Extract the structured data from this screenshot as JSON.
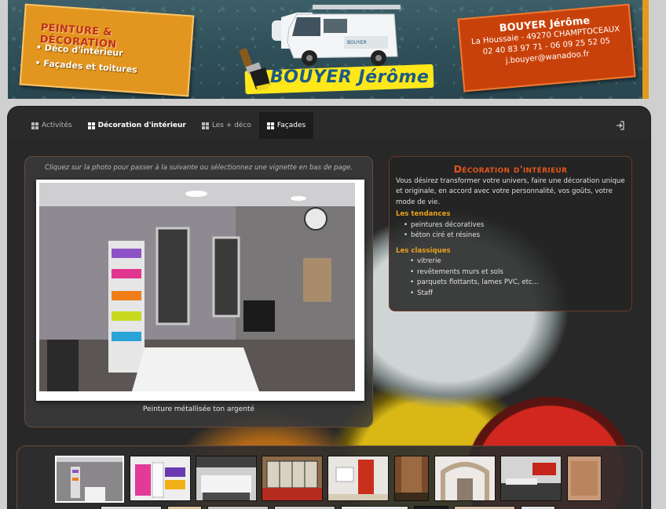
{
  "banner": {
    "left_title": "PEINTURE & DÉCORATION",
    "left_items": [
      "Déco d'intérieur",
      "Façades et toitures"
    ],
    "brand": "BOUYER Jérôme",
    "contact_name": "BOUYER Jérôme",
    "contact_address": "La Houssaie - 49270 CHAMPTOCEAUX",
    "contact_phone": "02 40 83 97 71 - 06 09 25 52 05",
    "contact_email": "j.bouyer@wanadoo.fr"
  },
  "nav": {
    "items": [
      {
        "label": "Activités"
      },
      {
        "label": "Décoration d'intérieur"
      },
      {
        "label": "Les + déco"
      },
      {
        "label": "Façades"
      }
    ],
    "active_index": 3,
    "login_icon": "sign-in-icon"
  },
  "gallery": {
    "hint": "Cliquez sur la photo pour passer à la suivante ou sélectionnez une vignette en bas de page.",
    "caption": "Peinture métallisée ton argenté",
    "selected_thumb": 0,
    "thumb_count_visible_row1": 9
  },
  "info": {
    "title": "Décoration d'intérieur",
    "intro": "Vous désirez transformer votre univers, faire une décoration unique et originale, en accord avec votre personnalité, vos goûts, votre mode de vie.",
    "sections": [
      {
        "heading": "Les tendances",
        "items": [
          "peintures décoratives",
          "béton ciré et résines"
        ]
      },
      {
        "heading": "Les classiques",
        "items": [
          "vitrerie",
          "revêtements murs et sols",
          "parquets flottants, lames PVC, etc...",
          "Staff"
        ]
      }
    ]
  },
  "colors": {
    "accent_orange": "#e2561a",
    "heading_gold": "#e9a11e",
    "sticker_left": "#e3961f",
    "sticker_right": "#c9410a",
    "banner_bg": "#2f4f58"
  }
}
